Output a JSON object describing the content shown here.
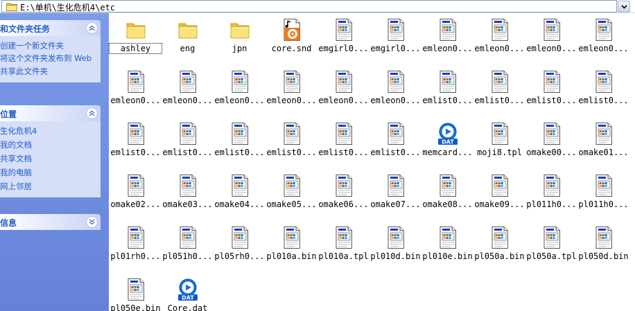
{
  "address": {
    "path": "E:\\单机\\生化危机4\\etc"
  },
  "taskpane": {
    "file_tasks": {
      "title": "和文件夹任务",
      "links": [
        "创建一个新文件夹",
        "将这个文件夹发布到 Web",
        "共享此文件夹"
      ]
    },
    "other_places": {
      "title": "位置",
      "links": [
        "生化危机4",
        "我的文档",
        "共享文档",
        "我的电脑",
        "网上邻居"
      ]
    },
    "details": {
      "title": "信息"
    }
  },
  "files": [
    {
      "name": "ashley",
      "type": "folder"
    },
    {
      "name": "eng",
      "type": "folder"
    },
    {
      "name": "jpn",
      "type": "folder"
    },
    {
      "name": "core.snd",
      "type": "audio"
    },
    {
      "name": "emgirl0...",
      "type": "image"
    },
    {
      "name": "emgirl0...",
      "type": "image"
    },
    {
      "name": "emleon0...",
      "type": "image"
    },
    {
      "name": "emleon0...",
      "type": "image"
    },
    {
      "name": "emleon0...",
      "type": "image"
    },
    {
      "name": "emleon0...",
      "type": "image"
    },
    {
      "name": "emleon0...",
      "type": "image"
    },
    {
      "name": "emleon0...",
      "type": "image"
    },
    {
      "name": "emleon0...",
      "type": "image"
    },
    {
      "name": "emleon0...",
      "type": "image"
    },
    {
      "name": "emleon0...",
      "type": "image"
    },
    {
      "name": "emleon0...",
      "type": "image"
    },
    {
      "name": "emlist0...",
      "type": "image"
    },
    {
      "name": "emlist0...",
      "type": "image"
    },
    {
      "name": "emlist0...",
      "type": "image"
    },
    {
      "name": "emlist0...",
      "type": "image"
    },
    {
      "name": "emlist0...",
      "type": "image"
    },
    {
      "name": "emlist0...",
      "type": "image"
    },
    {
      "name": "emlist0...",
      "type": "image"
    },
    {
      "name": "emlist0...",
      "type": "image"
    },
    {
      "name": "emlist0...",
      "type": "image"
    },
    {
      "name": "emlist0...",
      "type": "image"
    },
    {
      "name": "memcard...",
      "type": "dat"
    },
    {
      "name": "moji8.tpl",
      "type": "image"
    },
    {
      "name": "omake00...",
      "type": "image"
    },
    {
      "name": "omake01...",
      "type": "image"
    },
    {
      "name": "omake02...",
      "type": "image"
    },
    {
      "name": "omake03...",
      "type": "image"
    },
    {
      "name": "omake04...",
      "type": "image"
    },
    {
      "name": "omake05...",
      "type": "image"
    },
    {
      "name": "omake06...",
      "type": "image"
    },
    {
      "name": "omake07...",
      "type": "image"
    },
    {
      "name": "omake08...",
      "type": "image"
    },
    {
      "name": "omake09...",
      "type": "image"
    },
    {
      "name": "pl011h0...",
      "type": "image"
    },
    {
      "name": "pl011h0...",
      "type": "image"
    },
    {
      "name": "pl01rh0...",
      "type": "image"
    },
    {
      "name": "pl051h0...",
      "type": "image"
    },
    {
      "name": "pl05rh0...",
      "type": "image"
    },
    {
      "name": "pl010a.bin",
      "type": "image"
    },
    {
      "name": "pl010a.tpl",
      "type": "image"
    },
    {
      "name": "pl010d.bin",
      "type": "image"
    },
    {
      "name": "pl010e.bin",
      "type": "image"
    },
    {
      "name": "pl050a.bin",
      "type": "image"
    },
    {
      "name": "pl050a.tpl",
      "type": "image"
    },
    {
      "name": "pl050d.bin",
      "type": "image"
    },
    {
      "name": "pl050e.bin",
      "type": "image"
    },
    {
      "name": "Core.dat",
      "type": "dat"
    }
  ],
  "selected_index": 0,
  "colors": {
    "taskpane_bg": "#6f8fe0",
    "panel_link": "#215dc6",
    "folder": "#f5d66a",
    "dat_blue": "#1c6fe0"
  }
}
